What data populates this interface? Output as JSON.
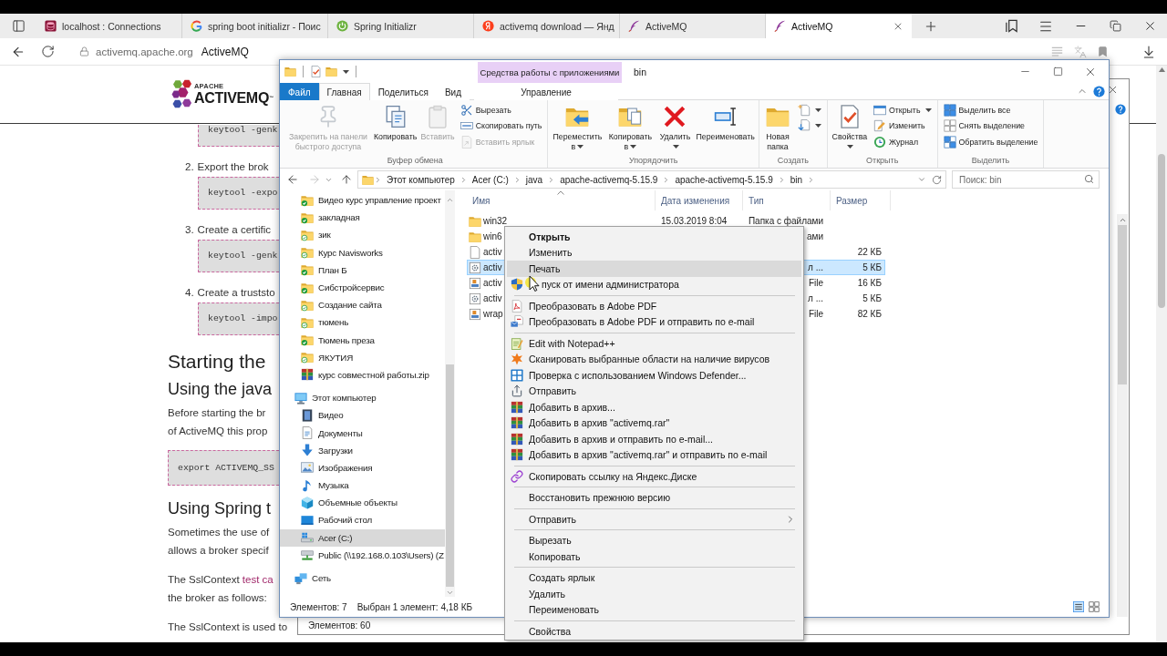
{
  "browser": {
    "tabs": [
      {
        "title": "localhost : Connections",
        "kind": "db",
        "selected": false
      },
      {
        "title": "spring boot initializr - Поис",
        "kind": "google",
        "selected": false
      },
      {
        "title": "Spring Initializr",
        "kind": "spring",
        "selected": false
      },
      {
        "title": "activemq download — Янд",
        "kind": "yandex",
        "selected": false
      },
      {
        "title": "ActiveMQ",
        "kind": "feather",
        "selected": false
      },
      {
        "title": "ActiveMQ",
        "kind": "feather",
        "selected": true
      }
    ],
    "address": {
      "host": "activemq.apache.org",
      "title": "ActiveMQ"
    }
  },
  "web_page": {
    "logo": {
      "overline": "APACHE",
      "name": "ACTIVEMQ$^{™}$"
    },
    "blocks": [
      {
        "kind": "stepcode",
        "code": "keytool -genk"
      },
      {
        "kind": "step",
        "number": "2.",
        "text": "Export the brok",
        "code": "keytool -expo"
      },
      {
        "kind": "step",
        "number": "3.",
        "text": "Create a certific",
        "code": "keytool -genk"
      },
      {
        "kind": "step",
        "number": "4.",
        "text": "Create a truststo",
        "code": "keytool -impo"
      },
      {
        "kind": "h1",
        "text": "Starting the"
      },
      {
        "kind": "h2",
        "text": "Using the java"
      },
      {
        "kind": "para",
        "lines": [
          {
            "text": "Before starting the br"
          },
          {
            "text": "of ActiveMQ this prop"
          }
        ]
      },
      {
        "kind": "code",
        "code": "export ACTIVEMQ_SS"
      },
      {
        "kind": "h2",
        "text": "Using Spring t"
      },
      {
        "kind": "para",
        "lines": [
          {
            "text": "Sometimes the use of"
          },
          {
            "text": "allows a broker specif"
          }
        ]
      },
      {
        "kind": "para",
        "lines": [
          {
            "text": "The SslContext ",
            "link": "test ca"
          },
          {
            "text": "the broker as follows:"
          }
        ]
      },
      {
        "kind": "para",
        "lines": [
          {
            "text": "The SslContext is used to"
          }
        ]
      }
    ]
  },
  "background_window": {
    "status": "Элементов: 60"
  },
  "explorer": {
    "context_group": "Средства работы с приложениями",
    "title": "bin",
    "tabs": [
      {
        "label": "Файл",
        "kind": "file",
        "selected": false
      },
      {
        "label": "Главная",
        "kind": "tab",
        "selected": true
      },
      {
        "label": "Поделиться",
        "kind": "tab",
        "selected": false
      },
      {
        "label": "Вид",
        "kind": "tab",
        "selected": false
      },
      {
        "label": "Управление",
        "kind": "context",
        "selected": false
      }
    ],
    "ribbon_groups": [
      {
        "label": "Буфер обмена",
        "large": [
          {
            "kind": "pin",
            "label": "Закрепить на панели быстрого доступа",
            "disabled": true,
            "dropdown": false
          },
          {
            "kind": "copy",
            "label": "Копировать",
            "disabled": false,
            "dropdown": false
          },
          {
            "kind": "paste",
            "label": "Вставить",
            "disabled": true,
            "dropdown": false
          }
        ],
        "small": [
          {
            "kind": "cut",
            "label": "Вырезать",
            "disabled": false,
            "dropdown": false
          },
          {
            "kind": "copypath",
            "label": "Скопировать путь",
            "disabled": false,
            "dropdown": false
          },
          {
            "kind": "pasteshortcut",
            "label": "Вставить ярлык",
            "disabled": true,
            "dropdown": false
          }
        ]
      },
      {
        "label": "Упорядочить",
        "large": [
          {
            "kind": "move",
            "label": "Переместить в",
            "disabled": false,
            "dropdown": true
          },
          {
            "kind": "copyto",
            "label": "Копировать в",
            "disabled": false,
            "dropdown": true
          },
          {
            "kind": "delete",
            "label": "Удалить",
            "disabled": false,
            "dropdown": true
          },
          {
            "kind": "rename",
            "label": "Переименовать",
            "disabled": false,
            "dropdown": false
          }
        ]
      },
      {
        "label": "Создать",
        "large": [
          {
            "kind": "newfolder",
            "label": "Новая папка",
            "disabled": false,
            "dropdown": false
          }
        ],
        "small": [
          {
            "kind": "newitem",
            "disabled": false,
            "dropdown": true
          },
          {
            "kind": "easyaccess",
            "disabled": false,
            "dropdown": true
          }
        ]
      },
      {
        "label": "Открыть",
        "large": [
          {
            "kind": "properties",
            "label": "Свойства",
            "disabled": false,
            "dropdown": true
          }
        ],
        "small": [
          {
            "kind": "open",
            "label": "Открыть",
            "disabled": false,
            "dropdown": true
          },
          {
            "kind": "edit",
            "label": "Изменить",
            "disabled": false,
            "dropdown": false
          },
          {
            "kind": "history",
            "label": "Журнал",
            "disabled": false,
            "dropdown": false
          }
        ]
      },
      {
        "label": "Выделить",
        "small": [
          {
            "kind": "selectall",
            "label": "Выделить все",
            "disabled": false,
            "dropdown": false
          },
          {
            "kind": "selectnone",
            "label": "Снять выделение",
            "disabled": false,
            "dropdown": false
          },
          {
            "kind": "invert",
            "label": "Обратить выделение",
            "disabled": false,
            "dropdown": false
          }
        ]
      }
    ],
    "address_bar": {
      "forward_disabled": true,
      "path": [
        "Этот компьютер",
        "Acer (C:)",
        "java",
        "apache-activemq-5.15.9",
        "apache-activemq-5.15.9",
        "bin"
      ]
    },
    "search": {
      "placeholder": "Поиск: bin"
    },
    "nav_pane": {
      "items": [
        {
          "label": "Видео курс управление проект",
          "kind": "synced",
          "selected": false
        },
        {
          "label": "закладная",
          "kind": "synced",
          "selected": false
        },
        {
          "label": "зик",
          "kind": "cloud",
          "selected": false
        },
        {
          "label": "Курс Navisworks",
          "kind": "cloud",
          "selected": false
        },
        {
          "label": "План Б",
          "kind": "synced",
          "selected": false
        },
        {
          "label": "Сибстройсервис",
          "kind": "synced",
          "selected": false
        },
        {
          "label": "Создание сайта",
          "kind": "cloud",
          "selected": false
        },
        {
          "label": "тюмень",
          "kind": "cloud",
          "selected": false
        },
        {
          "label": "Тюмень преза",
          "kind": "synced",
          "selected": false
        },
        {
          "label": "ЯКУТИЯ",
          "kind": "cloud",
          "selected": false
        },
        {
          "label": "курс совместной работы.zip",
          "kind": "zip",
          "selected": false
        }
      ],
      "tree": [
        {
          "label": "Этот компьютер",
          "kind": "computer",
          "selected": false,
          "children": [
            {
              "label": "Видео",
              "kind": "video",
              "selected": false
            },
            {
              "label": "Документы",
              "kind": "documents",
              "selected": false
            },
            {
              "label": "Загрузки",
              "kind": "downloads",
              "selected": false
            },
            {
              "label": "Изображения",
              "kind": "pictures",
              "selected": false
            },
            {
              "label": "Музыка",
              "kind": "music",
              "selected": false
            },
            {
              "label": "Объемные объекты",
              "kind": "objects",
              "selected": false
            },
            {
              "label": "Рабочий стол",
              "kind": "desktop",
              "selected": false
            },
            {
              "label": "Acer (C:)",
              "kind": "drive",
              "selected": true
            },
            {
              "label": "Public (\\\\192.168.0.103\\Users) (Z",
              "kind": "netdrive",
              "selected": false
            }
          ]
        },
        {
          "label": "Сеть",
          "kind": "network",
          "selected": false
        }
      ]
    },
    "file_list": {
      "columns": [
        "Имя",
        "Дата изменения",
        "Тип",
        "Размер"
      ],
      "rows": [
        {
          "kind": "folder",
          "name": "win32",
          "date": "15.03.2019 8:04",
          "type": "Папка с файлами",
          "selected": false
        },
        {
          "kind": "folder",
          "name": "win6",
          "type": "ами",
          "selected": false
        },
        {
          "kind": "file",
          "name": "activ",
          "size": "22 КБ",
          "selected": false
        },
        {
          "kind": "config",
          "name": "activ",
          "type": "л ...",
          "size": "5 КБ",
          "selected": true
        },
        {
          "kind": "script",
          "name": "activ",
          "type": "File",
          "size": "16 КБ",
          "selected": false
        },
        {
          "kind": "config",
          "name": "activ",
          "type": "л ...",
          "size": "5 КБ",
          "selected": false
        },
        {
          "kind": "script",
          "name": "wrap",
          "type": "File",
          "size": "82 КБ",
          "selected": false
        }
      ]
    },
    "status_bar": {
      "count": "Элементов: 7",
      "selection": "Выбран 1 элемент: 4,18 КБ"
    }
  },
  "context_menu": {
    "groups": [
      [
        {
          "label": "Открыть",
          "kind": "text",
          "default": true,
          "highlighted": false
        },
        {
          "label": "Изменить",
          "kind": "text",
          "default": false,
          "highlighted": false
        },
        {
          "label": "Печать",
          "kind": "text",
          "default": false,
          "highlighted": true
        },
        {
          "label": "пуск от имени администратора",
          "kind": "shield",
          "default": false,
          "highlighted": false
        }
      ],
      [
        {
          "label": "Преобразовать в Adobe PDF",
          "kind": "pdf",
          "default": false,
          "highlighted": false
        },
        {
          "label": "Преобразовать в Adobe PDF и отправить по e-mail",
          "kind": "pdfmail",
          "default": false,
          "highlighted": false
        }
      ],
      [
        {
          "label": "Edit with Notepad++",
          "kind": "notepad",
          "default": false,
          "highlighted": false
        },
        {
          "label": "Сканировать выбранные области на наличие вирусов",
          "kind": "antivirus",
          "default": false,
          "highlighted": false
        },
        {
          "label": "Проверка с использованием Windows Defender...",
          "kind": "defender",
          "default": false,
          "highlighted": false
        },
        {
          "label": "Отправить",
          "kind": "share",
          "default": false,
          "highlighted": false
        },
        {
          "label": "Добавить в архив...",
          "kind": "archive",
          "default": false,
          "highlighted": false
        },
        {
          "label": "Добавить в архив \"activemq.rar\"",
          "kind": "archive",
          "default": false,
          "highlighted": false
        },
        {
          "label": "Добавить в архив и отправить по e-mail...",
          "kind": "archive",
          "default": false,
          "highlighted": false
        },
        {
          "label": "Добавить в архив \"activemq.rar\" и отправить по e-mail",
          "kind": "archive",
          "default": false,
          "highlighted": false
        }
      ],
      [
        {
          "label": "Скопировать ссылку на Яндекс.Диске",
          "kind": "link",
          "default": false,
          "highlighted": false
        }
      ],
      [
        {
          "label": "Восстановить прежнюю версию",
          "kind": "text",
          "default": false,
          "highlighted": false
        }
      ],
      [
        {
          "label": "Отправить",
          "kind": "submenu",
          "default": false,
          "highlighted": false
        }
      ],
      [
        {
          "label": "Вырезать",
          "kind": "text",
          "default": false,
          "highlighted": false
        },
        {
          "label": "Копировать",
          "kind": "text",
          "default": false,
          "highlighted": false
        }
      ],
      [
        {
          "label": "Создать ярлык",
          "kind": "text",
          "default": false,
          "highlighted": false
        },
        {
          "label": "Удалить",
          "kind": "text",
          "default": false,
          "highlighted": false
        },
        {
          "label": "Переименовать",
          "kind": "text",
          "default": false,
          "highlighted": false
        }
      ],
      [
        {
          "label": "Свойства",
          "kind": "text",
          "default": false,
          "highlighted": false
        }
      ]
    ]
  }
}
